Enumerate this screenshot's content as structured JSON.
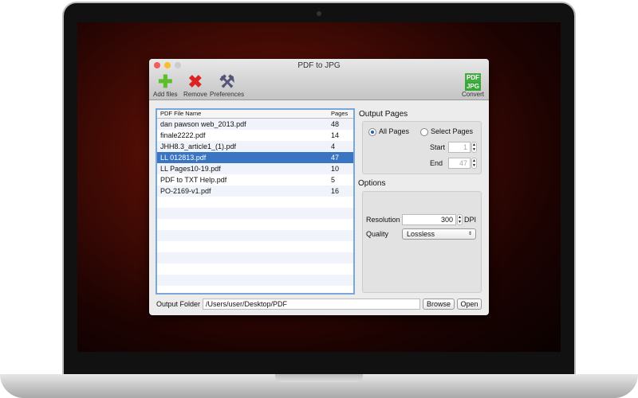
{
  "window": {
    "title": "PDF to JPG"
  },
  "toolbar": {
    "add": "Add files",
    "remove": "Remove",
    "preferences": "Preferences",
    "convert": "Convert"
  },
  "list": {
    "headers": [
      "PDF File Name",
      "Pages"
    ],
    "rows": [
      {
        "name": "dan pawson web_2013.pdf",
        "pages": "48"
      },
      {
        "name": "finale2222.pdf",
        "pages": "14"
      },
      {
        "name": "JHH8.3_article1_(1).pdf",
        "pages": "4"
      },
      {
        "name": "LL 012813.pdf",
        "pages": "47"
      },
      {
        "name": "LL Pages10-19.pdf",
        "pages": "10"
      },
      {
        "name": "PDF to TXT Help.pdf",
        "pages": "5"
      },
      {
        "name": "PO-2169-v1.pdf",
        "pages": "16"
      }
    ],
    "selected_index": 3
  },
  "output_pages": {
    "title": "Output Pages",
    "all": "All Pages",
    "select": "Select Pages",
    "start_label": "Start",
    "start": "1",
    "end_label": "End",
    "end": "47"
  },
  "options": {
    "title": "Options",
    "resolution_label": "Resolution",
    "resolution": "300",
    "dpi": "DPI",
    "quality_label": "Quality",
    "quality": "Lossless"
  },
  "output": {
    "label": "Output Folder",
    "path": "/Users/user/Desktop/PDF",
    "browse": "Browse",
    "open": "Open"
  }
}
